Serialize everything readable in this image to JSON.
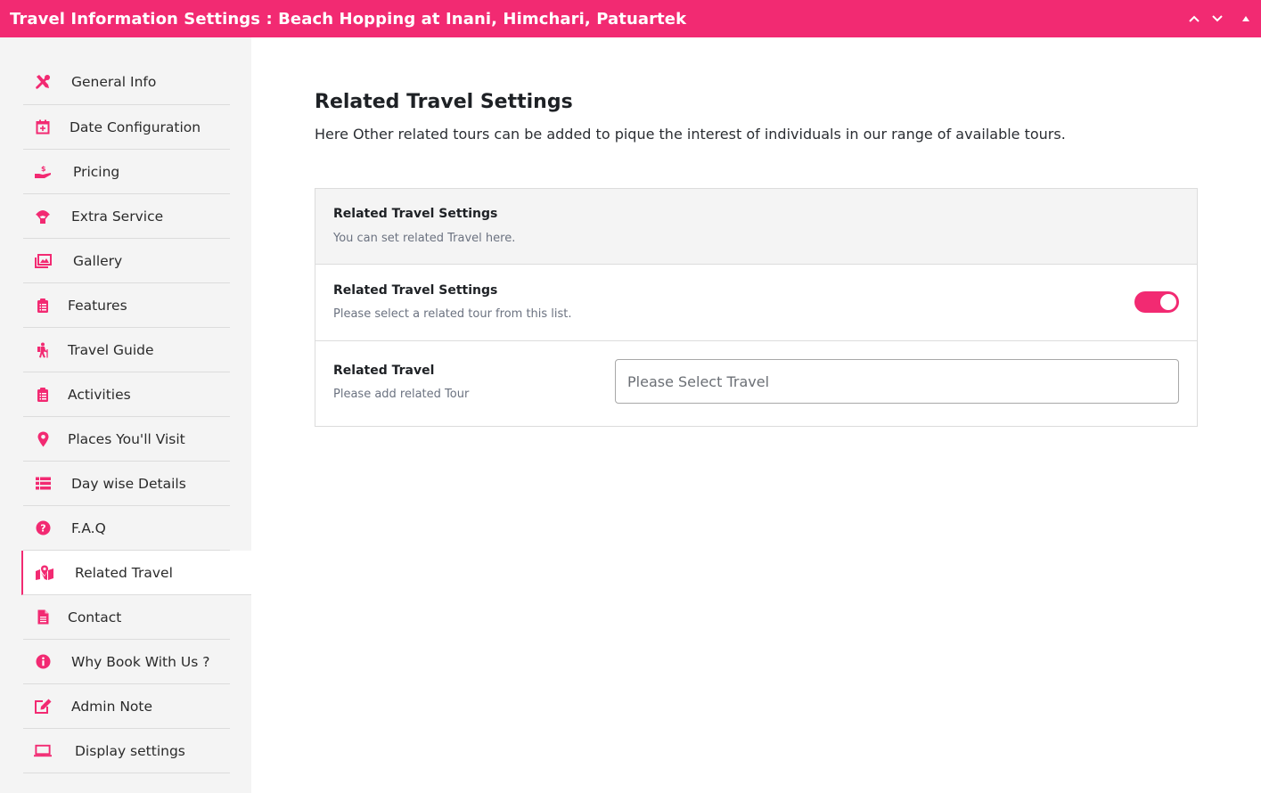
{
  "window": {
    "title": "Travel Information Settings : Beach Hopping at Inani, Himchari, Patuartek",
    "controls": [
      {
        "name": "collapse-up",
        "icon": "chevron-up-icon"
      },
      {
        "name": "collapse-down",
        "icon": "chevron-down-icon"
      },
      {
        "name": "toggle-panel",
        "icon": "triangle-up-icon"
      }
    ]
  },
  "theme": {
    "accent": "#f22a72",
    "sidebar_bg": "#f4f4f4"
  },
  "sidebar": {
    "active_index": 11,
    "items": [
      {
        "label": "General Info",
        "icon": "tools-icon"
      },
      {
        "label": "Date Configuration",
        "icon": "calendar-plus-icon"
      },
      {
        "label": "Pricing",
        "icon": "hand-dollar-icon"
      },
      {
        "label": "Extra Service",
        "icon": "parachute-box-icon"
      },
      {
        "label": "Gallery",
        "icon": "images-icon"
      },
      {
        "label": "Features",
        "icon": "clipboard-list-icon"
      },
      {
        "label": "Travel Guide",
        "icon": "hiking-icon"
      },
      {
        "label": "Activities",
        "icon": "clipboard-list-icon"
      },
      {
        "label": "Places You'll Visit",
        "icon": "map-marker-icon"
      },
      {
        "label": "Day wise Details",
        "icon": "list-icon"
      },
      {
        "label": "F.A.Q",
        "icon": "question-circle-icon"
      },
      {
        "label": "Related Travel",
        "icon": "map-location-icon"
      },
      {
        "label": "Contact",
        "icon": "file-alt-icon"
      },
      {
        "label": "Why Book With Us ?",
        "icon": "info-circle-icon"
      },
      {
        "label": "Admin Note",
        "icon": "edit-icon"
      },
      {
        "label": "Display settings",
        "icon": "laptop-icon"
      }
    ]
  },
  "main": {
    "title": "Related Travel Settings",
    "description": "Here Other related tours can be added to pique the interest of individuals in our range of available tours.",
    "panel": {
      "header": {
        "title": "Related Travel Settings",
        "subtitle": "You can set related Travel here."
      },
      "toggle_row": {
        "title": "Related Travel Settings",
        "subtitle": "Please select a related tour from this list.",
        "enabled": true
      },
      "select_row": {
        "title": "Related Travel",
        "subtitle": "Please add related Tour",
        "placeholder": "Please Select Travel",
        "value": ""
      }
    }
  }
}
